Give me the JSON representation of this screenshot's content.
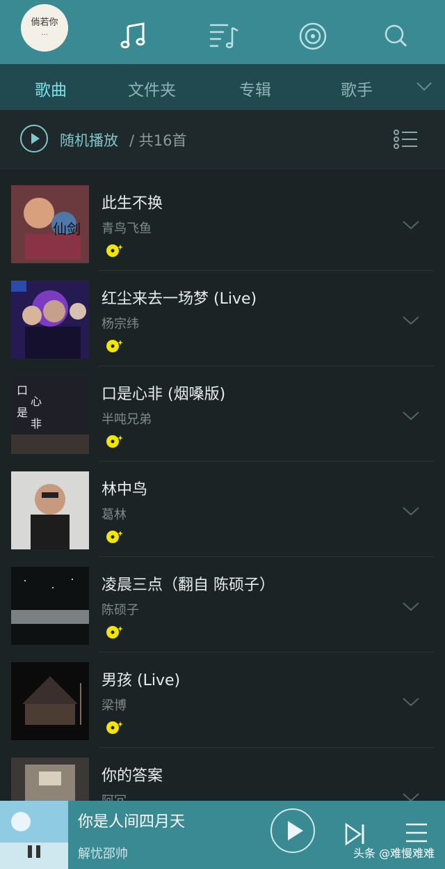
{
  "header": {
    "avatar_text": "倘若你…",
    "icons": [
      "music-note-icon",
      "playlist-icon",
      "radio-icon",
      "search-icon"
    ]
  },
  "tabs": [
    {
      "label": "歌曲",
      "active": true
    },
    {
      "label": "文件夹",
      "active": false
    },
    {
      "label": "专辑",
      "active": false
    },
    {
      "label": "歌手",
      "active": false
    }
  ],
  "shuffle": {
    "label": "随机播放",
    "count": "/ 共16首"
  },
  "songs": [
    {
      "title": "此生不换",
      "artist": "青鸟飞鱼"
    },
    {
      "title": "红尘来去一场梦 (Live)",
      "artist": "杨宗纬"
    },
    {
      "title": "口是心非 (烟嗓版)",
      "artist": "半吨兄弟"
    },
    {
      "title": "林中鸟",
      "artist": "葛林"
    },
    {
      "title": "凌晨三点（翻自 陈硕子）",
      "artist": "陈硕子"
    },
    {
      "title": "男孩 (Live)",
      "artist": "梁博"
    },
    {
      "title": "你的答案",
      "artist": "阿冗"
    }
  ],
  "player": {
    "title": "你是人间四月天",
    "artist": "解忧邵帅"
  },
  "watermark": "头条 @难慢难难",
  "colors": {
    "header": "#3a8a93",
    "tabbar": "#214a50",
    "accent": "#7fe0e6",
    "background": "#1c2325",
    "vip": "#f2e600"
  }
}
